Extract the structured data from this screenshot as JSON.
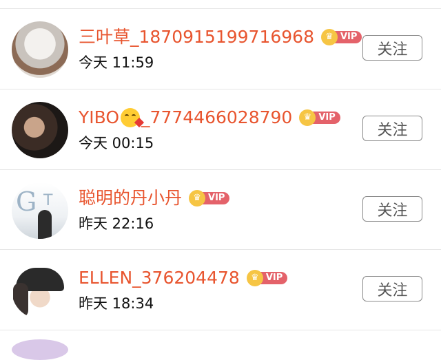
{
  "rows": [
    {
      "name": "三叶草_187091519971​6968",
      "emoji": "",
      "time": "今天 11:59",
      "vip": "VIP",
      "follow": "关注",
      "avatar": "avatar-anime-character"
    },
    {
      "name_pre": "YIBO",
      "name_post": "_7774466028790",
      "emoji": "kissing-face-emoji",
      "time": "今天 00:15",
      "vip": "VIP",
      "follow": "关注",
      "avatar": "avatar-person-photo"
    },
    {
      "name": "聪明的丹小丹",
      "emoji": "",
      "time": "昨天 22:16",
      "vip": "VIP",
      "follow": "关注",
      "avatar": "avatar-gt-logo-photo"
    },
    {
      "name": "ELLEN_376204478",
      "emoji": "",
      "time": "昨天 18:34",
      "vip": "VIP",
      "follow": "关注",
      "avatar": "avatar-cap-person-photo"
    }
  ],
  "colors": {
    "name": "#e8552f",
    "vip_tag": "#e4626a",
    "crown": "#f6c544",
    "divider": "#e6e6e6"
  }
}
